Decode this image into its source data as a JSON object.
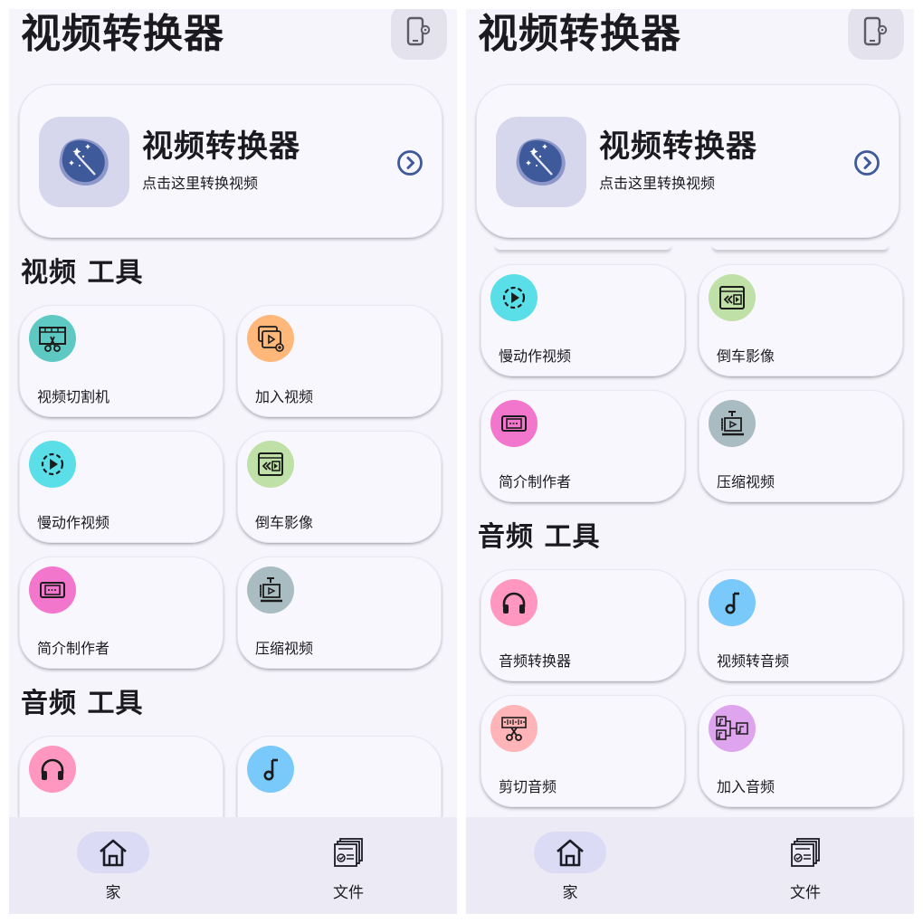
{
  "app": {
    "title": "视频转换器",
    "settings_icon": "phone-settings-icon"
  },
  "hero": {
    "title": "视频转换器",
    "subtitle": "点击这里转换视频",
    "icon": "magic-wand-icon",
    "arrow_icon": "chevron-right-circle-icon"
  },
  "sections": {
    "video": "视频 工具",
    "audio": "音频 工具"
  },
  "video_tools": [
    {
      "label": "视频切割机",
      "icon": "video-cut-icon",
      "color": "#5ec9c3"
    },
    {
      "label": "加入视频",
      "icon": "video-merge-icon",
      "color": "#ffb77a"
    },
    {
      "label": "慢动作视频",
      "icon": "slow-motion-icon",
      "color": "#5adfe9"
    },
    {
      "label": "倒车影像",
      "icon": "reverse-video-icon",
      "color": "#bfe0a6"
    },
    {
      "label": "简介制作者",
      "icon": "intro-maker-icon",
      "color": "#f276cc"
    },
    {
      "label": "压缩视频",
      "icon": "compress-video-icon",
      "color": "#a9bcc2"
    }
  ],
  "audio_tools": [
    {
      "label": "音频转换器",
      "icon": "headphones-icon",
      "color": "#ff97c0"
    },
    {
      "label": "视频转音频",
      "icon": "music-note-icon",
      "color": "#79c9fb"
    },
    {
      "label": "剪切音频",
      "icon": "audio-cut-icon",
      "color": "#ffb4b7"
    },
    {
      "label": "加入音频",
      "icon": "audio-merge-icon",
      "color": "#dea4ee"
    }
  ],
  "nav": {
    "home_label": "家",
    "files_label": "文件",
    "home_icon": "home-icon",
    "files_icon": "files-icon"
  },
  "colors": {
    "screen_bg": "#f6f5fc",
    "accent": "#3f5a9a",
    "nav_bg": "#eceaf4",
    "nav_active": "#dbdbf5"
  }
}
